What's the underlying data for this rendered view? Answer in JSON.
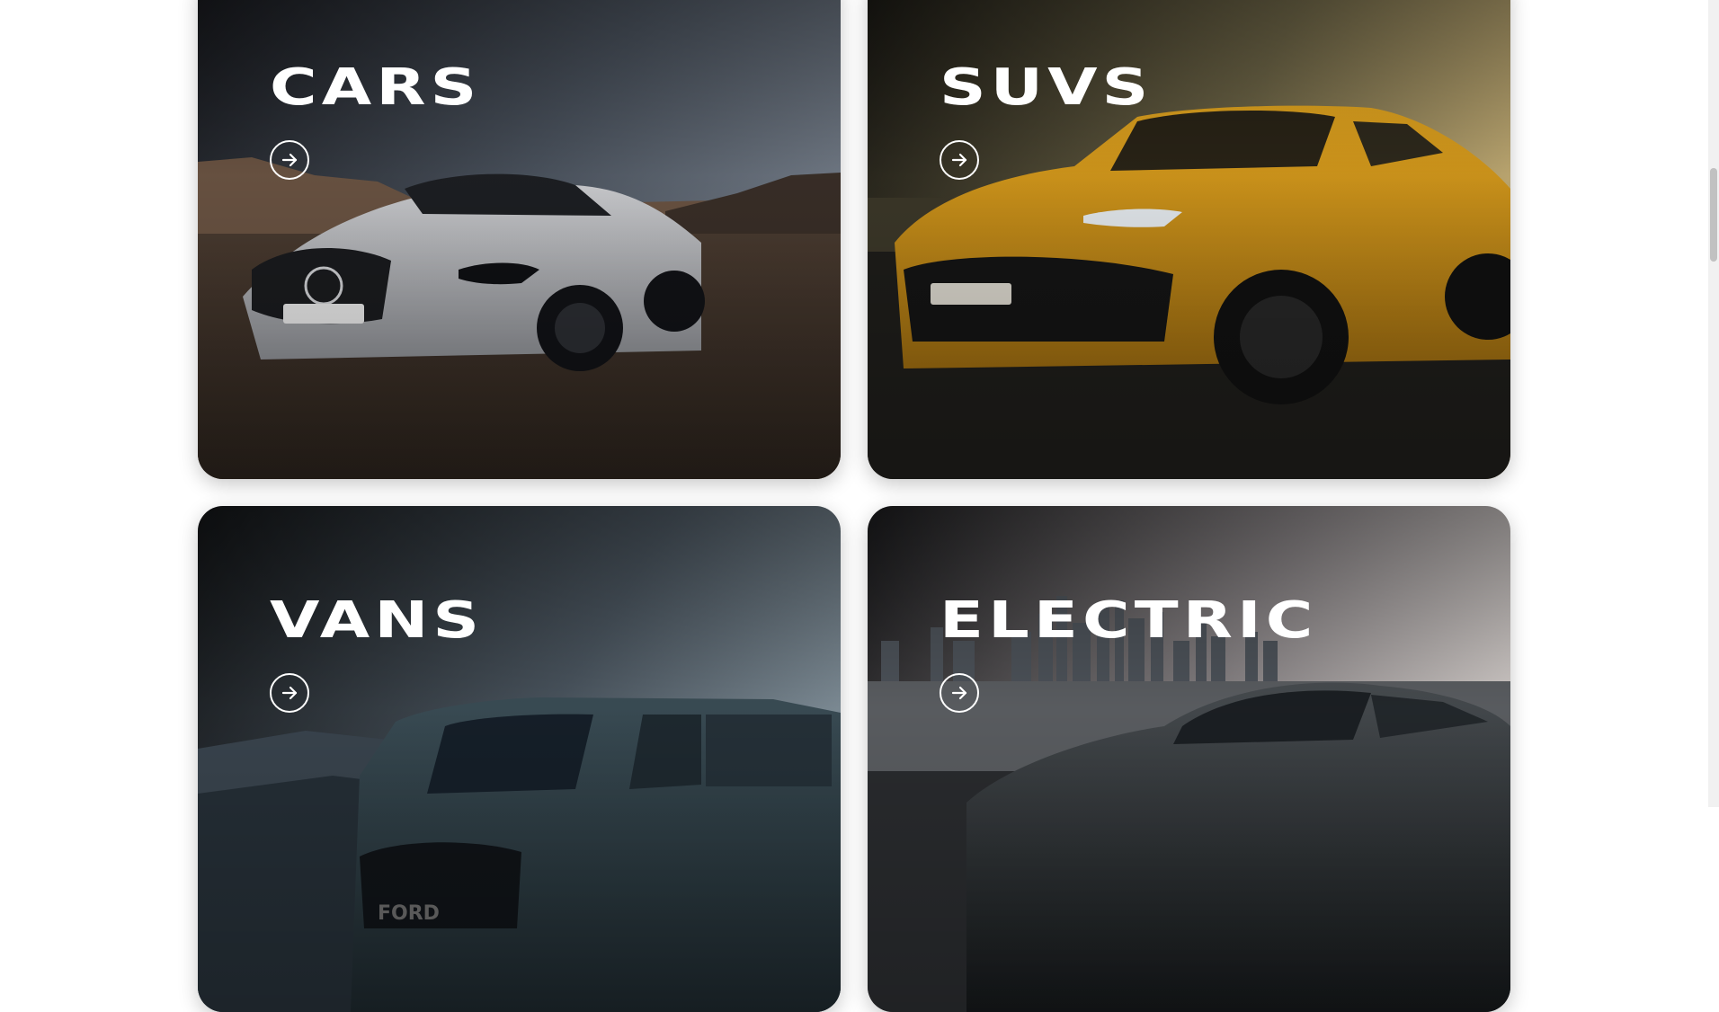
{
  "categories": [
    {
      "title": "CARS",
      "image": "silver sports coupe on desert road at dusk",
      "arrow_icon": "arrow-right-icon"
    },
    {
      "title": "SUVS",
      "image": "yellow luxury SUV at sunset",
      "arrow_icon": "arrow-right-icon"
    },
    {
      "title": "VANS",
      "image": "dark teal cargo van in mountains",
      "arrow_icon": "arrow-right-icon"
    },
    {
      "title": "ELECTRIC",
      "image": "dark electric sedan in front of city skyline",
      "arrow_icon": "arrow-right-icon"
    }
  ],
  "colors": {
    "text": "#ffffff",
    "cars_sky": "#5b6470",
    "suvs_accent": "#e0a21c",
    "vans_sky": "#6e7c86",
    "electric_sky": "#b9b4b6"
  }
}
